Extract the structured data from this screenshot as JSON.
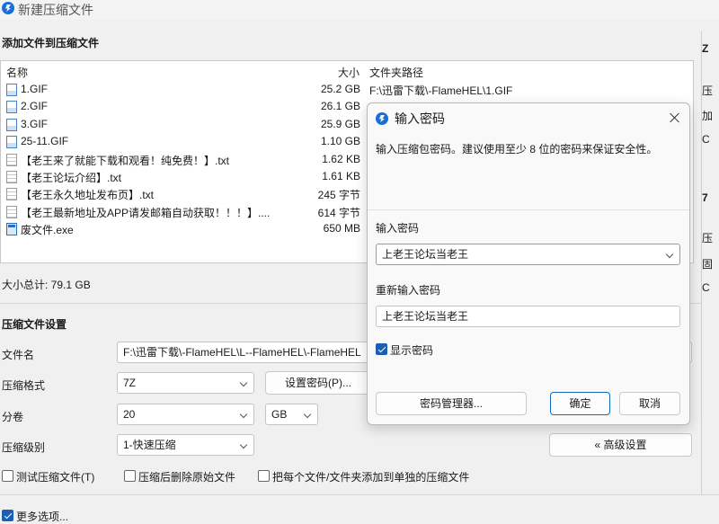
{
  "window": {
    "title": "新建压缩文件"
  },
  "add_section": {
    "title": "添加文件到压缩文件"
  },
  "file_list": {
    "columns": {
      "name": "名称",
      "size": "大小",
      "path": "文件夹路径"
    },
    "rows": [
      {
        "name": "1.GIF",
        "size": "25.2 GB",
        "path": "F:\\迅雷下载\\-FlameHEL\\1.GIF",
        "icon": "gif-file-icon"
      },
      {
        "name": "2.GIF",
        "size": "26.1 GB",
        "path": "",
        "icon": "gif-file-icon"
      },
      {
        "name": "3.GIF",
        "size": "25.9 GB",
        "path": "",
        "icon": "gif-file-icon"
      },
      {
        "name": "25-11.GIF",
        "size": "1.10 GB",
        "path": "",
        "icon": "gif-file-icon"
      },
      {
        "name": "【老王来了就能下载和观看！纯免费！】.txt",
        "size": "1.62 KB",
        "path": "",
        "icon": "text-file-icon"
      },
      {
        "name": "【老王论坛介绍】.txt",
        "size": "1.61 KB",
        "path": "",
        "icon": "text-file-icon"
      },
      {
        "name": "【老王永久地址发布页】.txt",
        "size": "245 字节",
        "path": "",
        "icon": "text-file-icon"
      },
      {
        "name": "【老王最新地址及APP请发邮箱自动获取！！！】....",
        "size": "614 字节",
        "path": "",
        "icon": "text-file-icon"
      },
      {
        "name": "废文件.exe",
        "size": "650 MB",
        "path": "",
        "icon": "exe-file-icon"
      }
    ]
  },
  "total": {
    "label": "大小总计: 79.1 GB"
  },
  "settings": {
    "title": "压缩文件设置",
    "filename_label": "文件名",
    "filename_value": "F:\\迅雷下载\\-FlameHEL\\L--FlameHEL\\-FlameHEL",
    "format_label": "压缩格式",
    "format_value": "7Z",
    "set_password_button": "设置密码(P)...",
    "volume_label": "分卷",
    "volume_value": "20",
    "volume_unit": "GB",
    "level_label": "压缩级别",
    "level_value": "1-快速压缩",
    "advanced_button": "« 高级设置",
    "test_archive": "测试压缩文件(T)",
    "delete_after": "压缩后删除原始文件",
    "separate_archives": "把每个文件/文件夹添加到单独的压缩文件"
  },
  "more_options": {
    "label": "更多选项..."
  },
  "side_panel": {
    "t1": "Z",
    "t2": "压",
    "t3": "加",
    "t4": "C",
    "t5": "7",
    "t6": "压",
    "t7": "固",
    "t8": "C"
  },
  "dialog": {
    "title": "输入密码",
    "description": "输入压缩包密码。建议使用至少 8 位的密码来保证安全性。",
    "password_label": "输入密码",
    "password_value": "上老王论坛当老王",
    "confirm_label": "重新输入密码",
    "confirm_value": "上老王论坛当老王",
    "show_password": "显示密码",
    "manager_button": "密码管理器...",
    "ok_button": "确定",
    "cancel_button": "取消"
  },
  "colors": {
    "accent": "#0f6cbd",
    "checkbox": "#1a5fb4",
    "icon_blue": "#1a6fd6"
  }
}
